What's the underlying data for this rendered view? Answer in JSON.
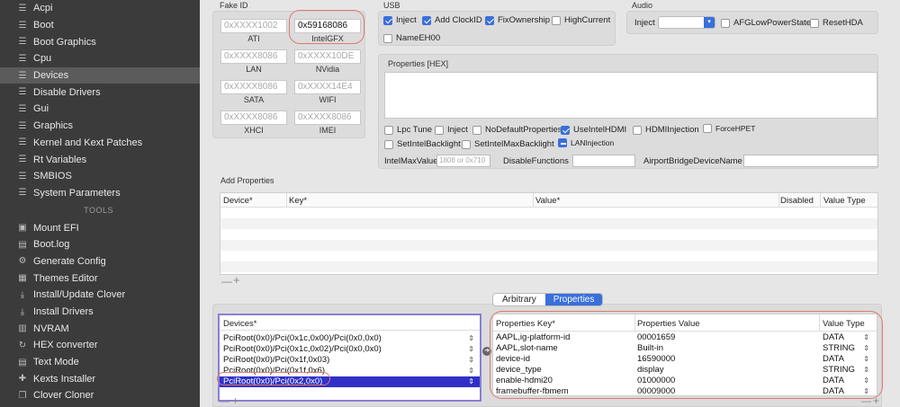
{
  "sidebar": {
    "items": [
      {
        "label": "Acpi"
      },
      {
        "label": "Boot"
      },
      {
        "label": "Boot Graphics"
      },
      {
        "label": "Cpu"
      },
      {
        "label": "Devices"
      },
      {
        "label": "Disable Drivers"
      },
      {
        "label": "Gui"
      },
      {
        "label": "Graphics"
      },
      {
        "label": "Kernel and Kext Patches"
      },
      {
        "label": "Rt Variables"
      },
      {
        "label": "SMBIOS"
      },
      {
        "label": "System Parameters"
      }
    ],
    "tools_header": "TOOLS",
    "tools": [
      {
        "label": "Mount EFI"
      },
      {
        "label": "Boot.log"
      },
      {
        "label": "Generate Config"
      },
      {
        "label": "Themes Editor"
      },
      {
        "label": "Install/Update Clover"
      },
      {
        "label": "Install Drivers"
      },
      {
        "label": "NVRAM"
      },
      {
        "label": "HEX converter"
      },
      {
        "label": "Text Mode"
      },
      {
        "label": "Kexts Installer"
      },
      {
        "label": "Clover Cloner"
      }
    ]
  },
  "fake_id": {
    "title": "Fake ID",
    "fields": [
      {
        "value": "0xXXXX1002",
        "label": "ATI"
      },
      {
        "value": "0x59168086",
        "label": "IntelGFX"
      },
      {
        "value": "0xXXXX8086",
        "label": "LAN"
      },
      {
        "value": "0xXXXX10DE",
        "label": "NVidia"
      },
      {
        "value": "0xXXXX8086",
        "label": "SATA"
      },
      {
        "value": "0xXXXX14E4",
        "label": "WIFI"
      },
      {
        "value": "0xXXXX8086",
        "label": "XHCI"
      },
      {
        "value": "0xXXXX8086",
        "label": "IMEI"
      }
    ]
  },
  "usb": {
    "title": "USB",
    "inject": "Inject",
    "add_clockid": "Add ClockID",
    "fix_ownership": "FixOwnership",
    "high_current": "HighCurrent",
    "name_eh00": "NameEH00"
  },
  "audio": {
    "title": "Audio",
    "inject_label": "Inject",
    "afg_low_power": "AFGLowPowerState",
    "reset_hda": "ResetHDA"
  },
  "properties_hex": {
    "title": "Properties [HEX]"
  },
  "options": {
    "lpc_tune": "Lpc Tune",
    "inject": "Inject",
    "no_default_properties": "NoDefaultProperties",
    "use_intel_hdmi": "UseIntelHDMI",
    "hdmi_injection": "HDMIInjection",
    "force_hpet": "ForceHPET",
    "set_intel_backlight": "SetIntelBacklight",
    "set_intel_max_backlight": "SetIntelMaxBacklight",
    "lan_injection": "LANInjection",
    "intel_max_value_label": "IntelMaxValue",
    "intel_max_value_placeholder": "1808 or 0x710",
    "disable_functions_label": "DisableFunctions",
    "airport_bridge_label": "AirportBridgeDeviceName"
  },
  "add_properties": {
    "title": "Add Properties",
    "columns": [
      "Device*",
      "Key*",
      "Value*",
      "Disabled",
      "Value Type"
    ],
    "minus": "—",
    "plus": "+"
  },
  "segment": {
    "arbitrary": "Arbitrary",
    "properties": "Properties"
  },
  "devices_table": {
    "header": "Devices*",
    "rows": [
      "PciRoot(0x0)/Pci(0x1c,0x00)/Pci(0x0,0x0)",
      "PciRoot(0x0)/Pci(0x1c,0x02)/Pci(0x0,0x0)",
      "PciRoot(0x0)/Pci(0x1f,0x03)",
      "PciRoot(0x0)/Pci(0x1f,0x6)",
      "PciRoot(0x0)/Pci(0x2,0x0)"
    ]
  },
  "props_table": {
    "columns": [
      "Properties Key*",
      "Properties Value",
      "Value Type"
    ],
    "rows": [
      {
        "key": "AAPL,ig-platform-id",
        "value": "00001659",
        "type": "DATA"
      },
      {
        "key": "AAPL,slot-name",
        "value": "Built-in",
        "type": "STRING"
      },
      {
        "key": "device-id",
        "value": "16590000",
        "type": "DATA"
      },
      {
        "key": "device_type",
        "value": "display",
        "type": "STRING"
      },
      {
        "key": "enable-hdmi20",
        "value": "01000000",
        "type": "DATA"
      },
      {
        "key": "framebuffer-fbmem",
        "value": "00009000",
        "type": "DATA"
      }
    ]
  },
  "colors": {
    "accent": "#3a6fdc",
    "highlight": "#e07a6f",
    "selection": "#3030c8",
    "device_border": "#8a7fd6"
  }
}
